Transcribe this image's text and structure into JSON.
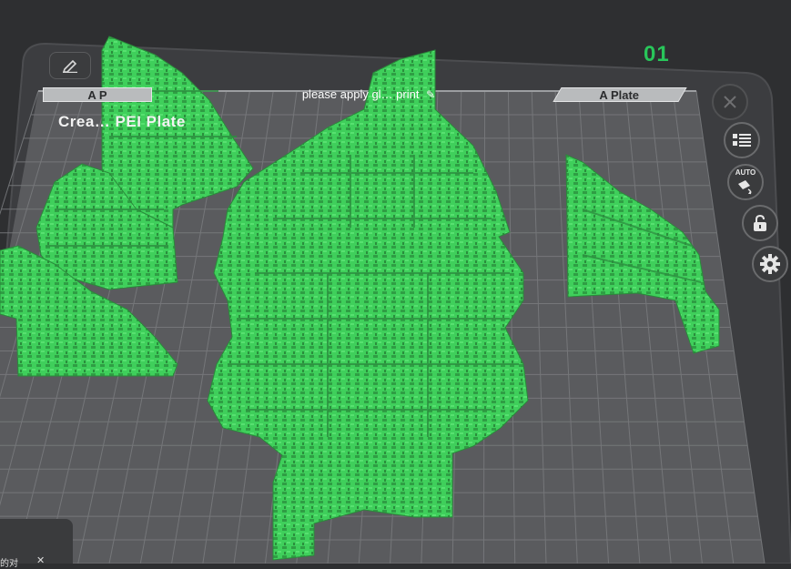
{
  "plate": {
    "number": "01",
    "tab_left_label": "A P",
    "tab_right_label": "A Plate",
    "notice": "please apply gl… print",
    "name": "Crea… PEI Plate"
  },
  "toast": {
    "text": "的对",
    "close": "✕"
  },
  "side_buttons": {
    "auto_label": "AUTO"
  },
  "colors": {
    "background": "#2e2f31",
    "plate_bed": "#5c5d60",
    "grid": "#7a7b7e",
    "model_green": "#3fcf5b",
    "accent_green": "#28c65a"
  },
  "icons": [
    "pencil-icon",
    "close-icon",
    "list-icon",
    "auto-orient-icon",
    "lock-icon",
    "gear-icon"
  ]
}
